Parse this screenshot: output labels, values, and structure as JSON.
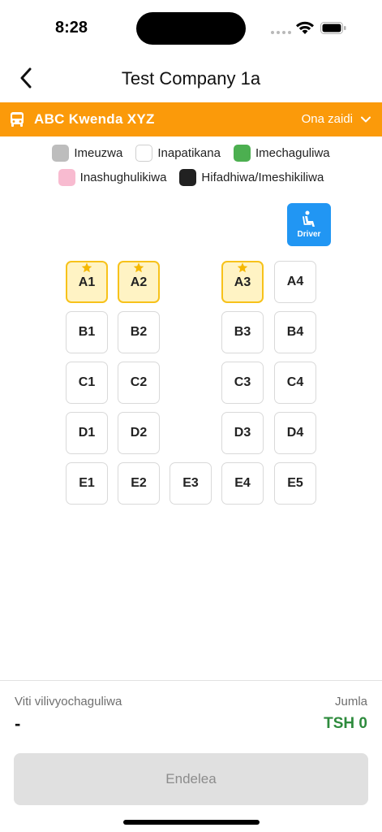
{
  "status_bar": {
    "time": "8:28"
  },
  "header": {
    "title": "Test Company 1a"
  },
  "route_bar": {
    "name": "ABC Kwenda XYZ",
    "more_label": "Ona zaidi",
    "color": "#fb9a0a"
  },
  "legend": {
    "items": [
      {
        "label": "Imeuzwa",
        "color": "#bdbdbd"
      },
      {
        "label": "Inapatikana",
        "color": "#ffffff"
      },
      {
        "label": "Imechaguliwa",
        "color": "#4caf50"
      },
      {
        "label": "Inashughulikiwa",
        "color": "#f8bbd0"
      },
      {
        "label": "Hifadhiwa/Imeshikiliwa",
        "color": "#212121"
      }
    ]
  },
  "driver": {
    "label": "Driver",
    "color": "#2196f3"
  },
  "seats": {
    "A1": {
      "label": "A1",
      "premium": true
    },
    "A2": {
      "label": "A2",
      "premium": true
    },
    "A3": {
      "label": "A3",
      "premium": true
    },
    "A4": {
      "label": "A4",
      "premium": false
    },
    "B1": {
      "label": "B1"
    },
    "B2": {
      "label": "B2"
    },
    "B3": {
      "label": "B3"
    },
    "B4": {
      "label": "B4"
    },
    "C1": {
      "label": "C1"
    },
    "C2": {
      "label": "C2"
    },
    "C3": {
      "label": "C3"
    },
    "C4": {
      "label": "C4"
    },
    "D1": {
      "label": "D1"
    },
    "D2": {
      "label": "D2"
    },
    "D3": {
      "label": "D3"
    },
    "D4": {
      "label": "D4"
    },
    "E1": {
      "label": "E1"
    },
    "E2": {
      "label": "E2"
    },
    "E3": {
      "label": "E3"
    },
    "E4": {
      "label": "E4"
    },
    "E5": {
      "label": "E5"
    }
  },
  "footer": {
    "selected_label": "Viti vilivyochaguliwa",
    "selected_value": "-",
    "total_label": "Jumla",
    "total_value": "TSH 0",
    "continue_label": "Endelea"
  }
}
